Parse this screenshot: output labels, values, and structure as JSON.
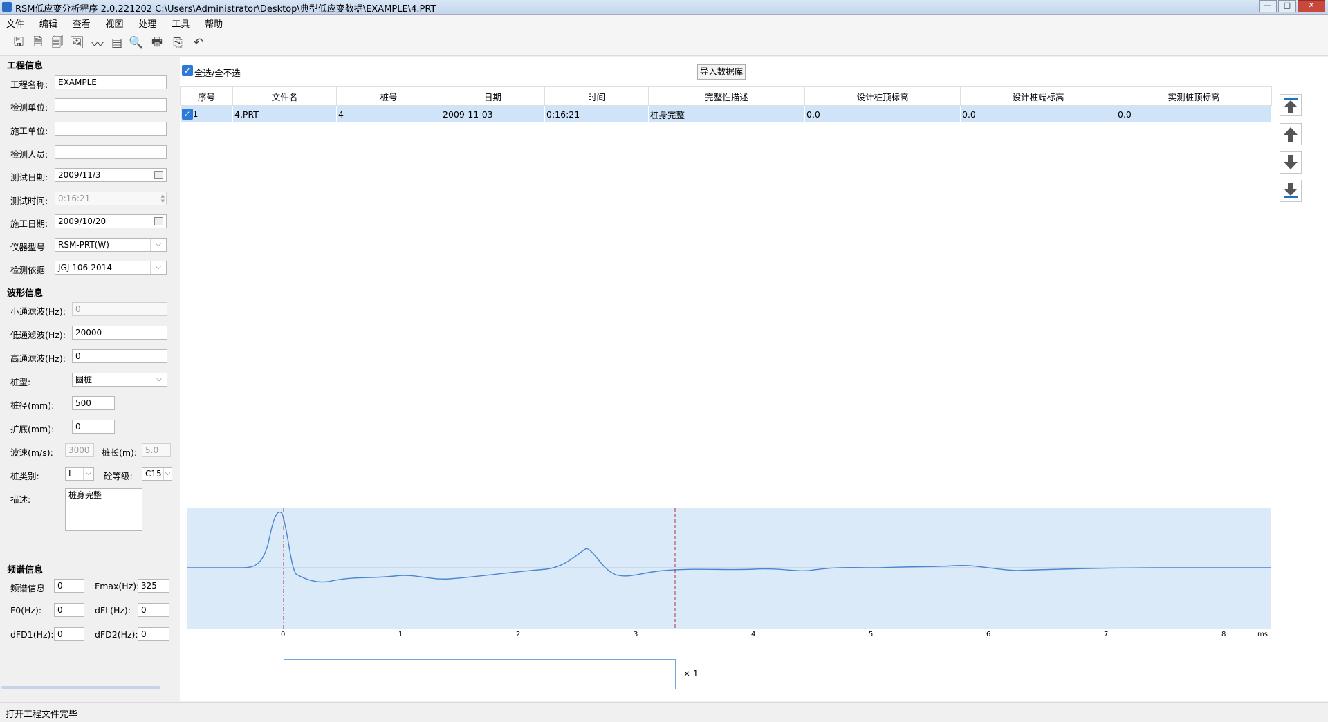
{
  "window": {
    "title": "RSM低应变分析程序 2.0.221202   C:\\Users\\Administrator\\Desktop\\典型低应变数据\\EXAMPLE\\4.PRT",
    "min_label": "—",
    "max_label": "□",
    "close_label": "✕"
  },
  "menu": [
    "文件",
    "编辑",
    "查看",
    "视图",
    "处理",
    "工具",
    "帮助"
  ],
  "toolbar_icons": [
    "save-icon",
    "document-icon",
    "document-list-icon",
    "image-icon",
    "waveform-icon",
    "report-icon",
    "search-document-icon",
    "printer-icon",
    "export-icon",
    "undo-icon"
  ],
  "project": {
    "section_title": "工程信息",
    "name_label": "工程名称:",
    "name_value": "EXAMPLE",
    "unit_label": "检测单位:",
    "unit_value": "",
    "builder_label": "施工单位:",
    "builder_value": "",
    "inspector_label": "检测人员:",
    "inspector_value": "",
    "test_date_label": "测试日期:",
    "test_date_value": "2009/11/3",
    "test_time_label": "测试时间:",
    "test_time_value": "0:16:21",
    "build_date_label": "施工日期:",
    "build_date_value": "2009/10/20",
    "instrument_label": "仪器型号",
    "instrument_value": "RSM-PRT(W)",
    "standard_label": "检测依据",
    "standard_value": "JGJ 106-2014"
  },
  "waveform_info": {
    "section_title": "波形信息",
    "small_filter_label": "小通滤波(Hz):",
    "small_filter_value": "0",
    "low_filter_label": "低通滤波(Hz):",
    "low_filter_value": "20000",
    "high_filter_label": "高通滤波(Hz):",
    "high_filter_value": "0",
    "pile_type_label": "桩型:",
    "pile_type_value": "圆桩",
    "diameter_label": "桩径(mm):",
    "diameter_value": "500",
    "enlarge_label": "扩底(mm):",
    "enlarge_value": "0",
    "speed_label": "波速(m/s):",
    "speed_value": "3000",
    "length_label": "桩长(m):",
    "length_value": "5.0",
    "category_label": "桩类别:",
    "category_value": "I",
    "grade_label": "砼等级:",
    "grade_value": "C15",
    "desc_label": "描述:",
    "desc_value": "桩身完整"
  },
  "spectrum": {
    "section_title": "频谱信息",
    "info_label": "频谱信息",
    "info_value": "0",
    "fmax_label": "Fmax(Hz):",
    "fmax_value": "325",
    "f0_label": "F0(Hz):",
    "f0_value": "0",
    "dfl_label": "dFL(Hz):",
    "dfl_value": "0",
    "dfd1_label": "dFD1(Hz):",
    "dfd1_value": "0",
    "dfd2_label": "dFD2(Hz):",
    "dfd2_value": "0"
  },
  "list": {
    "select_all_label": "全选/全不选",
    "import_label": "导入数据库",
    "columns": [
      "序号",
      "文件名",
      "桩号",
      "日期",
      "时间",
      "完整性描述",
      "设计桩顶标高",
      "设计桩端标高",
      "实测桩顶标高"
    ],
    "rows": [
      [
        "1",
        "4.PRT",
        "4",
        "2009-11-03",
        "0:16:21",
        "桩身完整",
        "0.0",
        "0.0",
        "0.0"
      ]
    ]
  },
  "side_buttons": [
    "move-top-icon",
    "move-up-icon",
    "move-down-icon",
    "move-bottom-icon"
  ],
  "waveform": {
    "x_ticks": [
      "0",
      "1",
      "2",
      "3",
      "4",
      "5",
      "6",
      "7",
      "8"
    ],
    "x_unit": "ms",
    "multiplier_label": "× 1",
    "background_color": "#dbeaf9",
    "trace_color": "#4a86d0",
    "marker_color": "#b03040"
  },
  "status": {
    "text": "打开工程文件完毕"
  }
}
